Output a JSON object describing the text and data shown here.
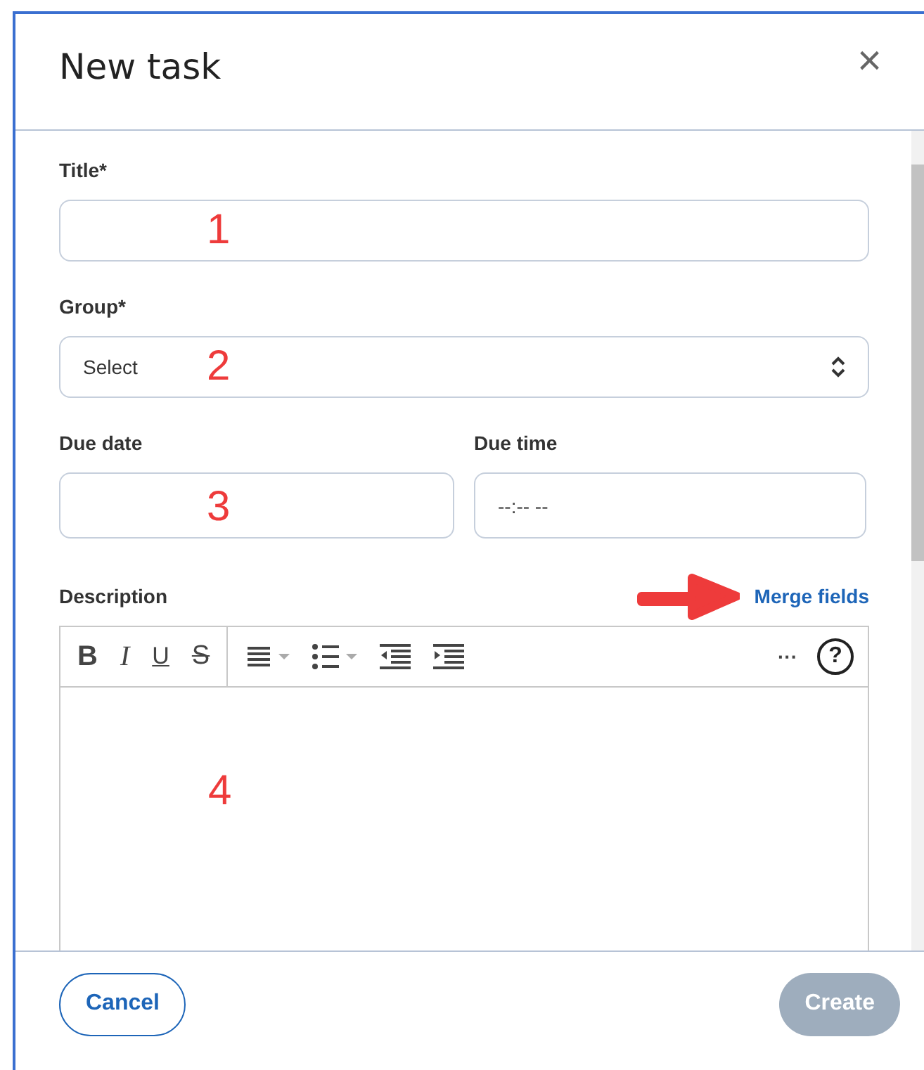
{
  "dialog": {
    "title": "New task",
    "close": "×"
  },
  "fields": [
    {
      "kind": "text",
      "label": "Title*",
      "annotation": "1"
    },
    {
      "kind": "select",
      "label": "Group*",
      "value": "Select",
      "annotation": "2"
    },
    {
      "kind": "date",
      "label": "Due date",
      "annotation": "3"
    },
    {
      "kind": "time",
      "label": "Due time",
      "placeholder": "--:-- --"
    }
  ],
  "description": {
    "label": "Description",
    "link": "Merge fields",
    "annotation": "4",
    "toolbar": [
      {
        "kind": "bold",
        "glyph": "B"
      },
      {
        "kind": "italic",
        "glyph": "I"
      },
      {
        "kind": "underline",
        "glyph": "U"
      },
      {
        "kind": "strike",
        "glyph": "S"
      },
      {
        "kind": "align"
      },
      {
        "kind": "bullets"
      },
      {
        "kind": "outdent"
      },
      {
        "kind": "indent"
      },
      {
        "kind": "more",
        "glyph": "···"
      },
      {
        "kind": "help",
        "glyph": "?"
      }
    ]
  },
  "buttons": [
    {
      "label": "Cancel",
      "kind": "secondary",
      "disabled": false
    },
    {
      "label": "Create",
      "kind": "primary",
      "disabled": true
    }
  ]
}
